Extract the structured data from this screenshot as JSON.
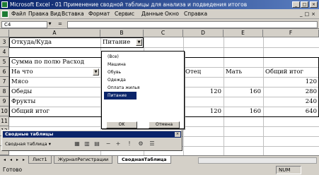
{
  "window": {
    "title": "Microsoft Excel - 01 Применение сводной таблицы для анализа и подведения итогов"
  },
  "menu": [
    "Файл",
    "Правка",
    "Вид",
    "Вставка",
    "Формат",
    "Сервис",
    "Данные",
    "Окно",
    "Справка"
  ],
  "namebox": {
    "value": "C4"
  },
  "columns": [
    "A",
    "B",
    "C",
    "D",
    "E",
    "F"
  ],
  "rows": [
    "3",
    "4",
    "5",
    "6",
    "7",
    "8",
    "9",
    "10",
    "11",
    "12",
    "13"
  ],
  "cells": {
    "a3": "Откуда/Куда",
    "b3": "Питание",
    "a5": "Сумма по полю Расход",
    "a6": "На что",
    "d6": "Отец",
    "e6": "Мать",
    "f6": "Общий итог",
    "a7": "Мясо",
    "f7": "120",
    "a8": "Обеды",
    "d8": "120",
    "e8": "160",
    "f8": "280",
    "a9": "Фрукты",
    "f9": "240",
    "a10": "Общий итог",
    "d10": "120",
    "e10": "160",
    "f10": "640"
  },
  "filter_dropdown": {
    "items": [
      "(Все)",
      "Машина",
      "Обувь",
      "Одежда",
      "Оплата жилья",
      "Питание"
    ],
    "selected": "Питание",
    "ok": "OK",
    "cancel": "Отмена"
  },
  "pivot_toolbar": {
    "title": "Сводные таблицы",
    "menu_label": "Сводная таблица",
    "icons": [
      "format-report-icon",
      "chart-wizard-icon",
      "wizard-icon",
      "hide-detail-icon",
      "show-detail-icon",
      "refresh-icon",
      "field-settings-icon",
      "field-list-icon"
    ]
  },
  "sheet_tabs": [
    "Лист1",
    "ЖурналРегистрации",
    "СводнаяТаблица"
  ],
  "active_tab": "СводнаяТаблица",
  "status": {
    "text": "Готово",
    "numlock": "NUM"
  }
}
